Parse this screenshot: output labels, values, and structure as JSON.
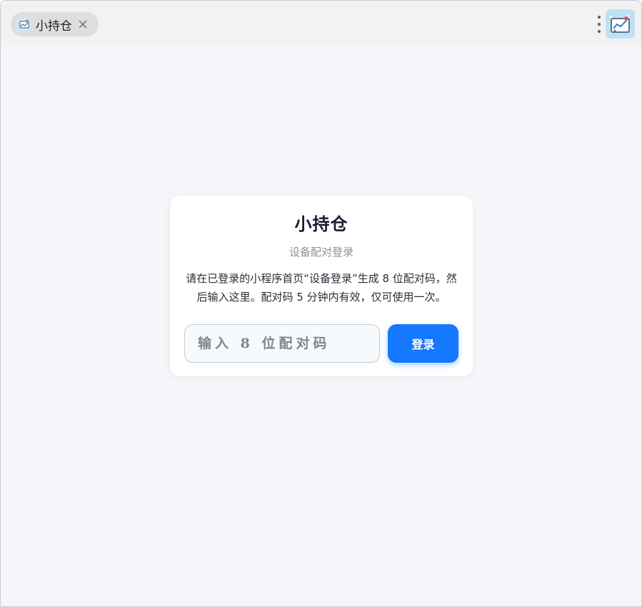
{
  "window": {
    "tab": {
      "title": "小持仓",
      "icon": "app-logo-icon",
      "close_icon": "close-icon"
    },
    "menu_icon": "more-vertical-icon",
    "avatar_icon": "app-logo-icon"
  },
  "login_card": {
    "title": "小持仓",
    "subtitle": "设备配对登录",
    "description": "请在已登录的小程序首页“设备登录”生成 8 位配对码，然后输入这里。配对码 5 分钟内有效，仅可使用一次。",
    "code_input": {
      "value": "",
      "placeholder": "输入 8 位配对码"
    },
    "login_label": "登录"
  },
  "colors": {
    "accent": "#1677ff",
    "background": "#f5f6f9",
    "card": "#ffffff",
    "title_text": "#161c2d"
  }
}
